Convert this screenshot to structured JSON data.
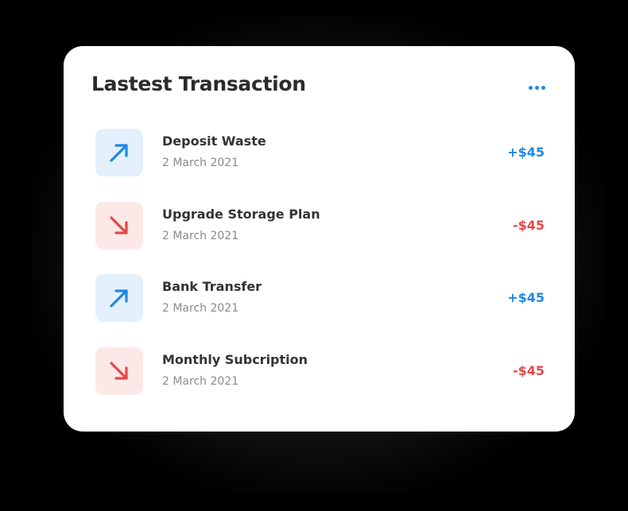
{
  "card": {
    "title": "Lastest Transaction",
    "menu_icon": "more-horizontal-icon"
  },
  "colors": {
    "incoming": "#1e88e5",
    "outgoing": "#e54848",
    "incoming_bg": "#e4f0fc",
    "outgoing_bg": "#fde8e8"
  },
  "transactions": [
    {
      "name": "Deposit Waste",
      "date": "2 March 2021",
      "amount": "+$45",
      "direction": "in",
      "icon": "arrow-up-right-icon"
    },
    {
      "name": "Upgrade Storage Plan",
      "date": "2 March 2021",
      "amount": "-$45",
      "direction": "out",
      "icon": "arrow-down-right-icon"
    },
    {
      "name": "Bank Transfer",
      "date": "2 March 2021",
      "amount": "+$45",
      "direction": "in",
      "icon": "arrow-up-right-icon"
    },
    {
      "name": "Monthly Subcription",
      "date": "2 March 2021",
      "amount": "-$45",
      "direction": "out",
      "icon": "arrow-down-right-icon"
    }
  ]
}
